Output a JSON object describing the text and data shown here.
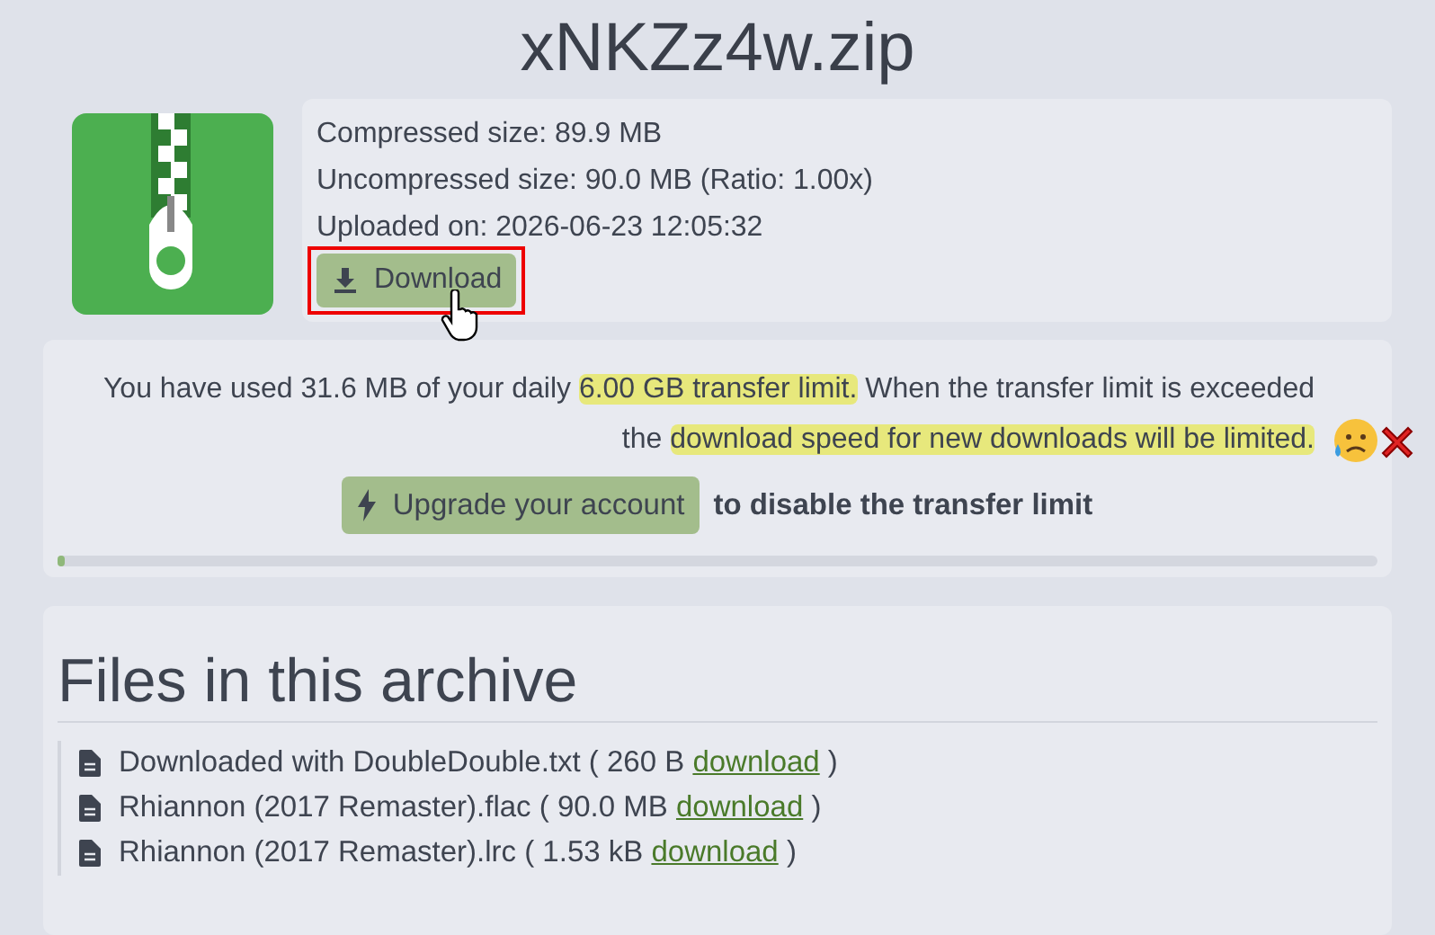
{
  "title": "xNKZz4w.zip",
  "info": {
    "lines": [
      "Compressed size: 89.9 MB",
      "Uncompressed size: 90.0 MB (Ratio: 1.00x)",
      "Uploaded on: 2026-06-23 12:05:32"
    ],
    "download_button": {
      "label": "Download",
      "outlined": true
    }
  },
  "notice": {
    "segments": [
      {
        "text": "You have used 31.6 MB of your daily ",
        "highlighted": false
      },
      {
        "text": "6.00 GB transfer limit.",
        "highlighted": true
      },
      {
        "text": " When the transfer limit is exceeded the ",
        "highlighted": false
      },
      {
        "text": "download speed for new downloads will be limited.",
        "highlighted": true
      }
    ],
    "upgrade_button": "Upgrade your account",
    "upgrade_text": "to disable the transfer limit",
    "level": 0.005
  },
  "files": {
    "heading": "Files in this archive",
    "items": [
      {
        "text": "Downloaded with DoubleDouble.txt ( 260 B ",
        "link": "download",
        "suffix": " )"
      },
      {
        "text": "Rhiannon (2017 Remaster).flac ( 90.0 MB ",
        "link": "download",
        "suffix": " )"
      },
      {
        "text": "Rhiannon (2017 Remaster).lrc ( 1.53 kB ",
        "link": "download",
        "suffix": " )"
      }
    ]
  }
}
